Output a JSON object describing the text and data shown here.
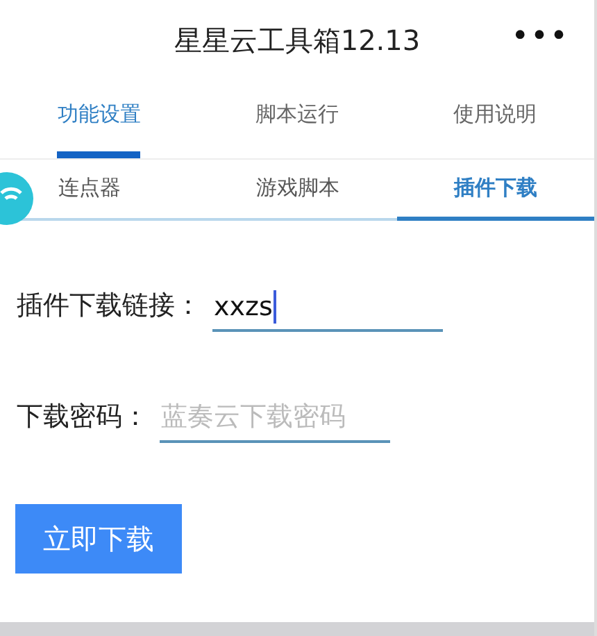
{
  "header": {
    "title": "星星云工具箱12.13",
    "menu": "•••"
  },
  "tabs": [
    {
      "label": "功能设置",
      "selected": true
    },
    {
      "label": "脚本运行",
      "selected": false
    },
    {
      "label": "使用说明",
      "selected": false
    }
  ],
  "subtabs": [
    {
      "label": "连点器",
      "selected": false
    },
    {
      "label": "游戏脚本",
      "selected": false
    },
    {
      "label": "插件下载",
      "selected": true
    }
  ],
  "fields": [
    {
      "label": "插件下载链接：",
      "value": "xxzs",
      "focused": true
    },
    {
      "label": "下载密码：",
      "placeholder": "蓝奏云下载密码",
      "focused": false
    }
  ],
  "button": "立即下载"
}
